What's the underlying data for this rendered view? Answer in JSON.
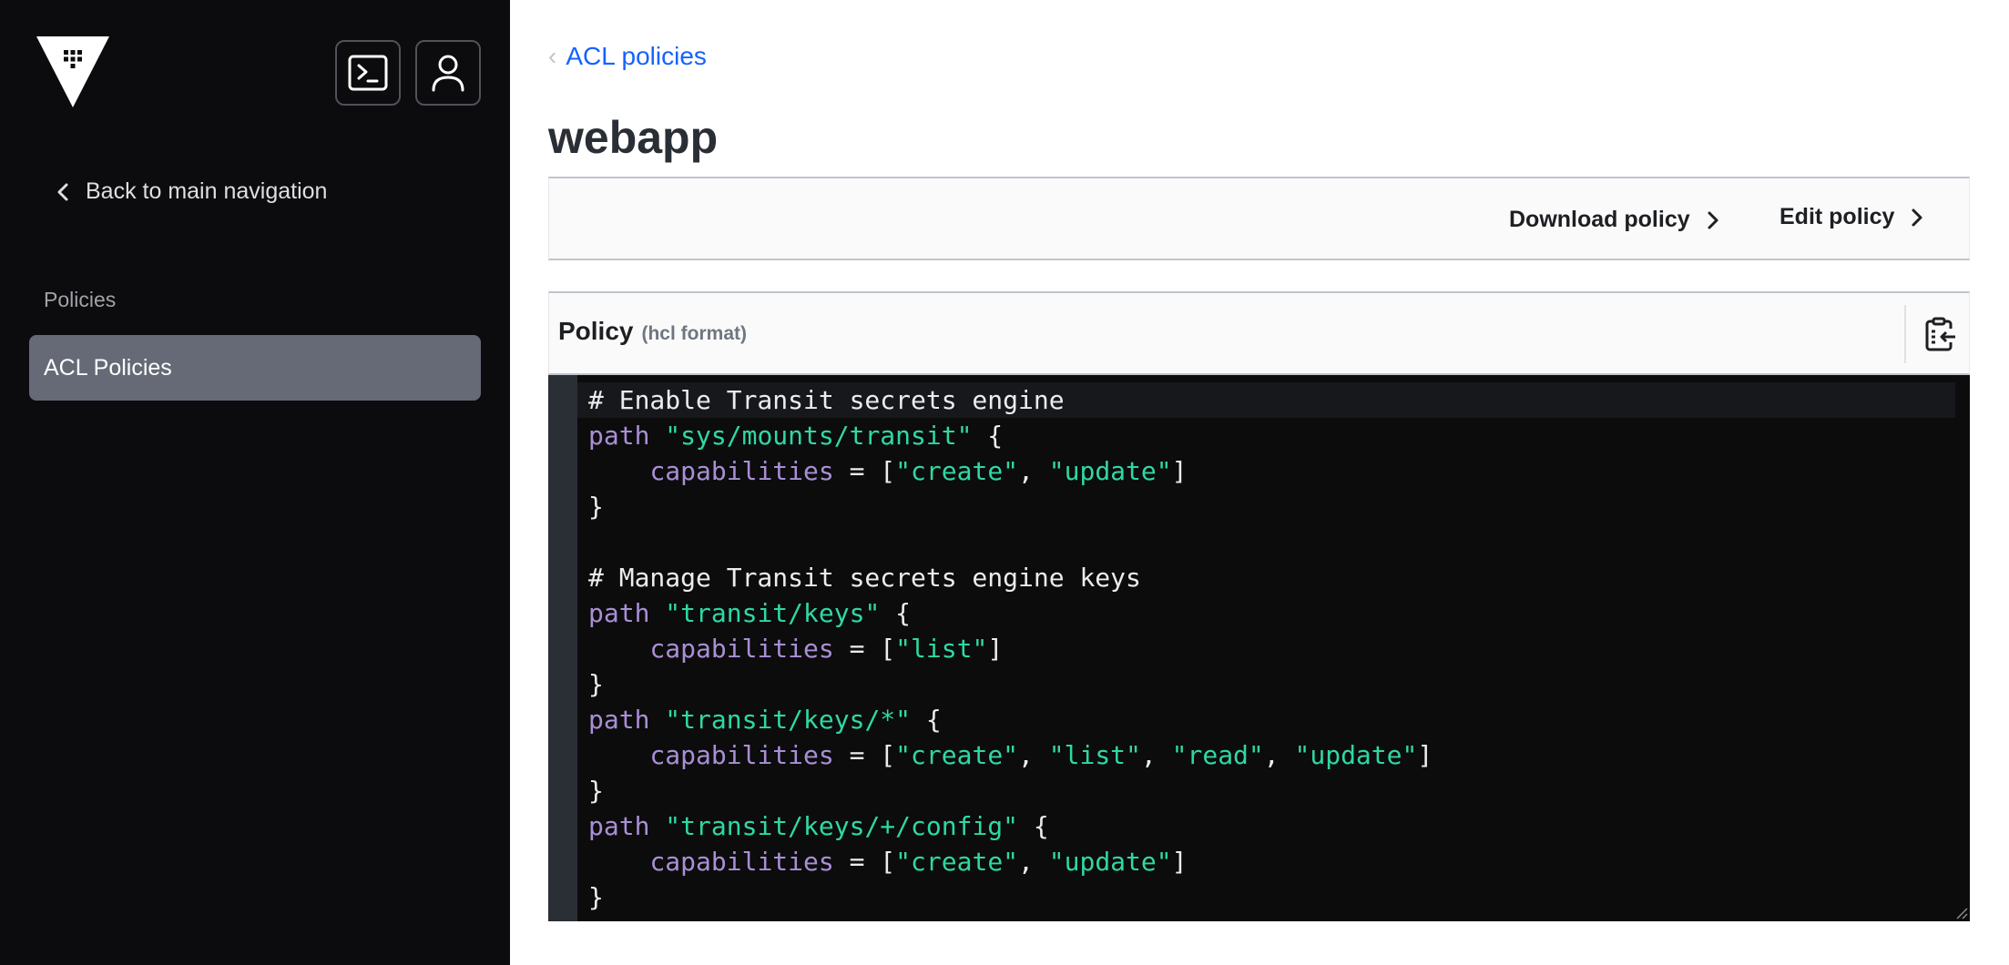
{
  "sidebar": {
    "logo": "vault-logo-icon",
    "console_button": "terminal-icon",
    "user_button": "user-icon",
    "back_link": "Back to main navigation",
    "section_label": "Policies",
    "items": [
      {
        "label": "ACL Policies",
        "active": true
      }
    ]
  },
  "main": {
    "breadcrumb": {
      "label": "ACL policies"
    },
    "title": "webapp",
    "toolbar": {
      "download_label": "Download policy",
      "edit_label": "Edit policy"
    },
    "policy": {
      "title": "Policy",
      "format": "(hcl format)",
      "copy_icon": "clipboard-copy-icon",
      "lines": [
        [
          {
            "t": "comment",
            "v": "# Enable Transit secrets engine"
          }
        ],
        [
          {
            "t": "kw",
            "v": "path"
          },
          {
            "t": "punc",
            "v": " "
          },
          {
            "t": "str",
            "v": "\"sys/mounts/transit\""
          },
          {
            "t": "punc",
            "v": " {"
          }
        ],
        [
          {
            "t": "punc",
            "v": "    "
          },
          {
            "t": "kw",
            "v": "capabilities"
          },
          {
            "t": "punc",
            "v": " = ["
          },
          {
            "t": "str",
            "v": "\"create\""
          },
          {
            "t": "punc",
            "v": ", "
          },
          {
            "t": "str",
            "v": "\"update\""
          },
          {
            "t": "punc",
            "v": "]"
          }
        ],
        [
          {
            "t": "punc",
            "v": "}"
          }
        ],
        [
          {
            "t": "punc",
            "v": ""
          }
        ],
        [
          {
            "t": "comment",
            "v": "# Manage Transit secrets engine keys"
          }
        ],
        [
          {
            "t": "kw",
            "v": "path"
          },
          {
            "t": "punc",
            "v": " "
          },
          {
            "t": "str",
            "v": "\"transit/keys\""
          },
          {
            "t": "punc",
            "v": " {"
          }
        ],
        [
          {
            "t": "punc",
            "v": "    "
          },
          {
            "t": "kw",
            "v": "capabilities"
          },
          {
            "t": "punc",
            "v": " = ["
          },
          {
            "t": "str",
            "v": "\"list\""
          },
          {
            "t": "punc",
            "v": "]"
          }
        ],
        [
          {
            "t": "punc",
            "v": "}"
          }
        ],
        [
          {
            "t": "kw",
            "v": "path"
          },
          {
            "t": "punc",
            "v": " "
          },
          {
            "t": "str",
            "v": "\"transit/keys/*\""
          },
          {
            "t": "punc",
            "v": " {"
          }
        ],
        [
          {
            "t": "punc",
            "v": "    "
          },
          {
            "t": "kw",
            "v": "capabilities"
          },
          {
            "t": "punc",
            "v": " = ["
          },
          {
            "t": "str",
            "v": "\"create\""
          },
          {
            "t": "punc",
            "v": ", "
          },
          {
            "t": "str",
            "v": "\"list\""
          },
          {
            "t": "punc",
            "v": ", "
          },
          {
            "t": "str",
            "v": "\"read\""
          },
          {
            "t": "punc",
            "v": ", "
          },
          {
            "t": "str",
            "v": "\"update\""
          },
          {
            "t": "punc",
            "v": "]"
          }
        ],
        [
          {
            "t": "punc",
            "v": "}"
          }
        ],
        [
          {
            "t": "kw",
            "v": "path"
          },
          {
            "t": "punc",
            "v": " "
          },
          {
            "t": "str",
            "v": "\"transit/keys/+/config\""
          },
          {
            "t": "punc",
            "v": " {"
          }
        ],
        [
          {
            "t": "punc",
            "v": "    "
          },
          {
            "t": "kw",
            "v": "capabilities"
          },
          {
            "t": "punc",
            "v": " = ["
          },
          {
            "t": "str",
            "v": "\"create\""
          },
          {
            "t": "punc",
            "v": ", "
          },
          {
            "t": "str",
            "v": "\"update\""
          },
          {
            "t": "punc",
            "v": "]"
          }
        ],
        [
          {
            "t": "punc",
            "v": "}"
          }
        ]
      ]
    }
  },
  "colors": {
    "sidebar_bg": "#0c0c0e",
    "nav_active_bg": "#656a76",
    "link": "#1563ff",
    "editor_bg": "#0c0c0c",
    "keyword": "#a98fd6",
    "string": "#2fd8a4"
  }
}
